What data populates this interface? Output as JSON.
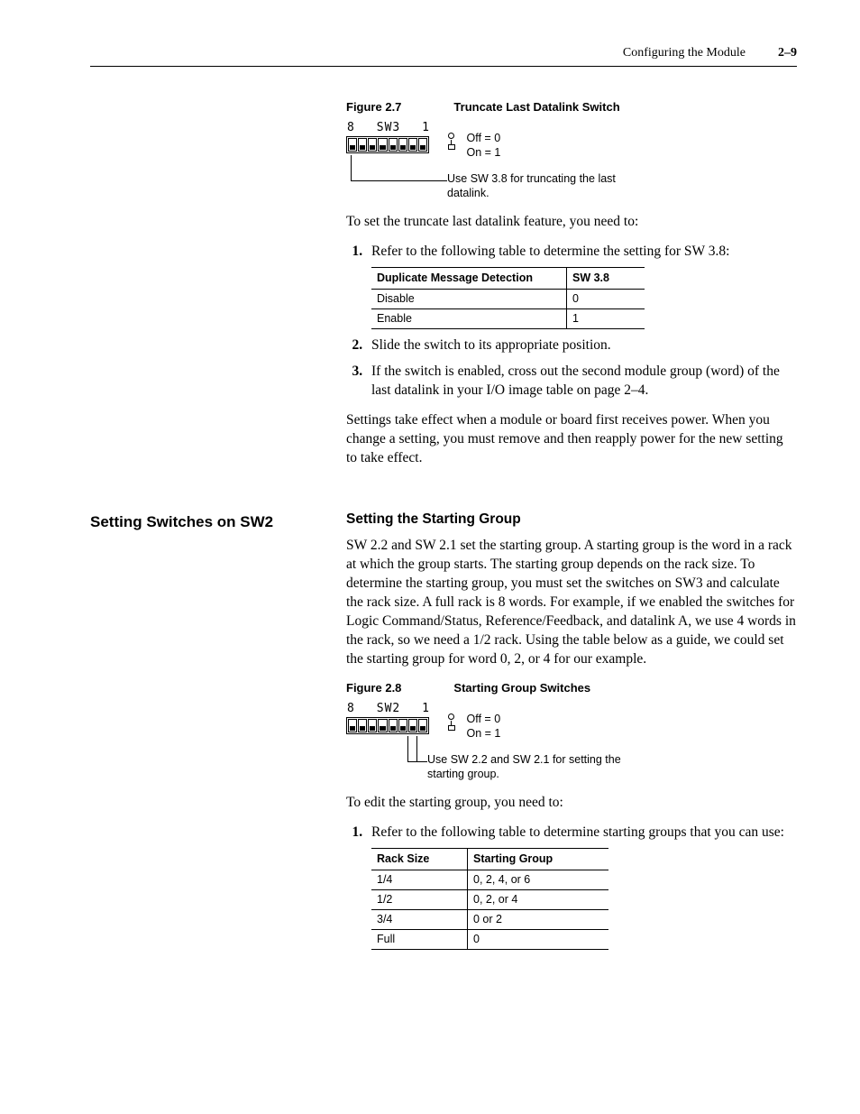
{
  "header": {
    "chapter": "Configuring the Module",
    "page": "2–9"
  },
  "fig1": {
    "id": "Figure 2.7",
    "title": "Truncate Last Datalink Switch",
    "dip_left": "8",
    "dip_name": "SW3",
    "dip_right": "1",
    "legend_off": "Off = 0",
    "legend_on": "On = 1",
    "callout": "Use SW 3.8 for truncating the last datalink."
  },
  "intro1": "To set the truncate last datalink feature, you need to:",
  "step1_1": "Refer to the following table to determine the setting for SW 3.8:",
  "table1": {
    "h1": "Duplicate Message Detection",
    "h2": "SW 3.8",
    "rows": [
      {
        "a": "Disable",
        "b": "0"
      },
      {
        "a": "Enable",
        "b": "1"
      }
    ]
  },
  "step1_2": "Slide the switch to its appropriate position.",
  "step1_3": "If the switch is enabled, cross out the second module group (word) of the last datalink in your I/O image table on page 2–4.",
  "para_power": "Settings take effect when a module or board first receives power. When you change a setting, you must remove and then reapply power for the new setting to take effect.",
  "left_heading": "Setting Switches on SW2",
  "sub_heading": "Setting the Starting Group",
  "para_sg": "SW 2.2 and SW 2.1 set the starting group. A starting group is the word in a rack at which the group starts. The starting group depends on the rack size. To determine the starting group, you must set the switches on SW3 and calculate the rack size. A full rack is 8 words. For example, if we enabled the switches for Logic Command/Status, Reference/Feedback, and datalink A, we use 4 words in the rack, so we need a 1/2 rack. Using the table below as a guide, we could set the starting group for word 0, 2, or 4 for our example.",
  "fig2": {
    "id": "Figure 2.8",
    "title": "Starting Group Switches",
    "dip_left": "8",
    "dip_name": "SW2",
    "dip_right": "1",
    "legend_off": "Off = 0",
    "legend_on": "On = 1",
    "callout": "Use SW 2.2 and SW 2.1 for setting the starting group."
  },
  "intro2": "To edit the starting group, you need to:",
  "step2_1": "Refer to the following table to determine starting groups that you can use:",
  "table2": {
    "h1": "Rack Size",
    "h2": "Starting Group",
    "rows": [
      {
        "a": "1/4",
        "b": "0, 2, 4, or 6"
      },
      {
        "a": "1/2",
        "b": "0, 2, or 4"
      },
      {
        "a": "3/4",
        "b": "0 or 2"
      },
      {
        "a": "Full",
        "b": "0"
      }
    ]
  }
}
